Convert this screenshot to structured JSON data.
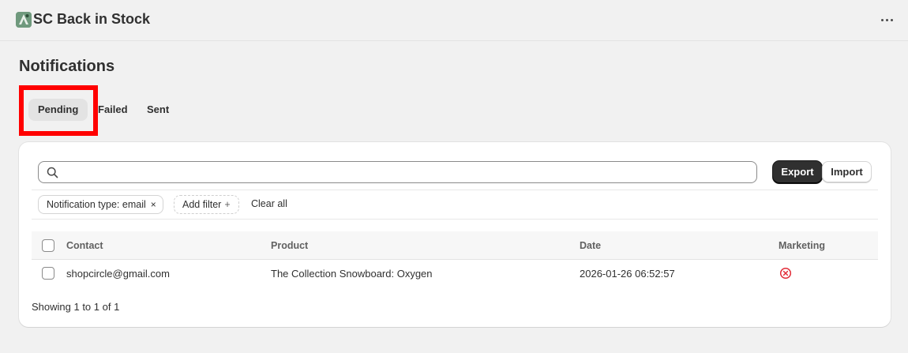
{
  "app": {
    "title": "SC Back in Stock",
    "more_icon": "ellipsis-horizontal-icon"
  },
  "page": {
    "title": "Notifications"
  },
  "tabs": [
    {
      "label": "Pending",
      "active": true
    },
    {
      "label": "Failed",
      "active": false
    },
    {
      "label": "Sent",
      "active": false
    }
  ],
  "toolbar": {
    "search_placeholder": "",
    "search_icon": "search-icon",
    "export_label": "Export",
    "import_label": "Import"
  },
  "filters": {
    "chips": [
      {
        "label": "Notification type: email",
        "remove": "×"
      }
    ],
    "add_filter_label": "Add filter",
    "add_filter_icon": "+",
    "clear_all_label": "Clear all"
  },
  "table": {
    "columns": [
      "Contact",
      "Product",
      "Date",
      "Marketing"
    ],
    "rows": [
      {
        "contact": "shopcircle@gmail.com",
        "product": "The Collection Snowboard: Oxygen",
        "date": "2026-01-26 06:52:57",
        "marketing": "not-subscribed-icon"
      }
    ],
    "footer": "Showing 1 to 1 of 1"
  },
  "colors": {
    "background": "#f1f1f1",
    "primary_button": "#303030",
    "highlight": "#ff0000",
    "marketing_off": "#e22c38"
  }
}
